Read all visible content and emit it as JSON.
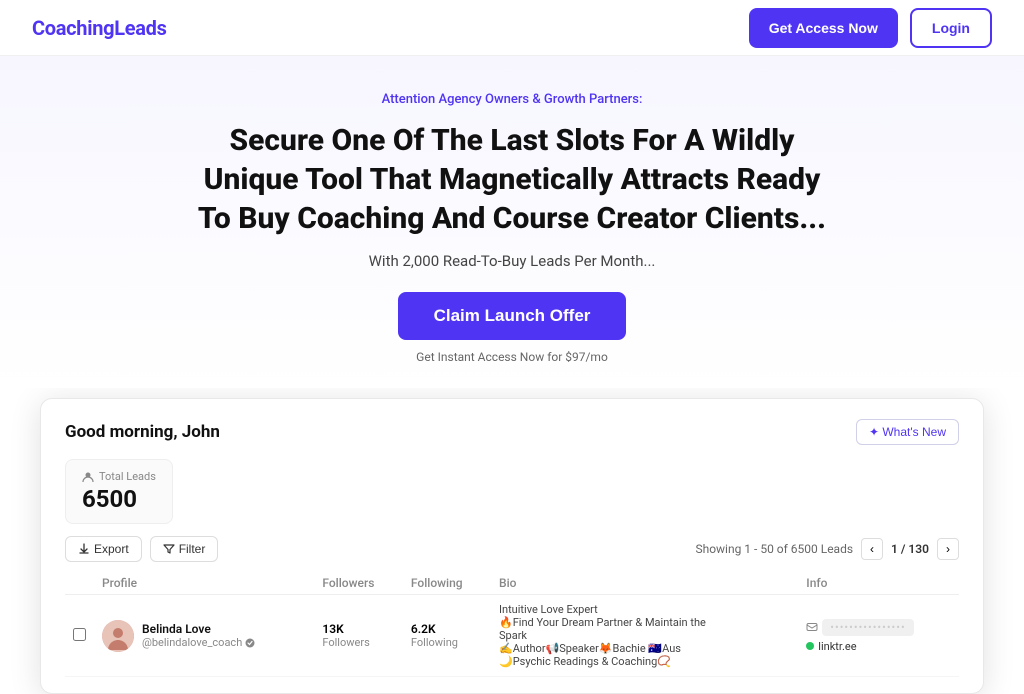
{
  "navbar": {
    "brand": "CoachingLeads",
    "cta_label": "Get Access Now",
    "login_label": "Login"
  },
  "hero": {
    "attention": "Attention Agency Owners & Growth Partners:",
    "headline": "Secure One Of The Last Slots For A Wildly Unique Tool That Magnetically Attracts Ready To Buy Coaching And Course Creator Clients...",
    "subheading": "With 2,000 Read-To-Buy Leads Per Month...",
    "cta_button": "Claim Launch Offer",
    "fine_print": "Get Instant Access Now for $97/mo"
  },
  "dashboard": {
    "greeting": "Good morning, John",
    "whats_new": "✦ What's New",
    "total_leads_label": "Total Leads",
    "total_leads_count": "6500",
    "export_label": "Export",
    "filter_label": "Filter",
    "pagination_info": "Showing 1 - 50 of 6500 Leads",
    "page_current": "1 / 130",
    "columns": {
      "profile": "Profile",
      "followers": "Followers",
      "following": "Following",
      "bio": "Bio",
      "info": "Info"
    },
    "row": {
      "name": "Belinda Love",
      "handle": "@belindalove_coach",
      "followers": "13K",
      "followers_label": "Followers",
      "following": "6.2K",
      "following_label": "Following",
      "bio_line1": "Intuitive Love Expert",
      "bio_line2": "🔥Find Your Dream Partner & Maintain the Spark",
      "bio_line3": "✍Author📢Speaker🦊Bachie 🇦🇺Aus",
      "bio_line4": "🌙Psychic Readings & Coaching📿",
      "email_blur": "••••••••••••••••",
      "link": "linktr.ee"
    }
  }
}
